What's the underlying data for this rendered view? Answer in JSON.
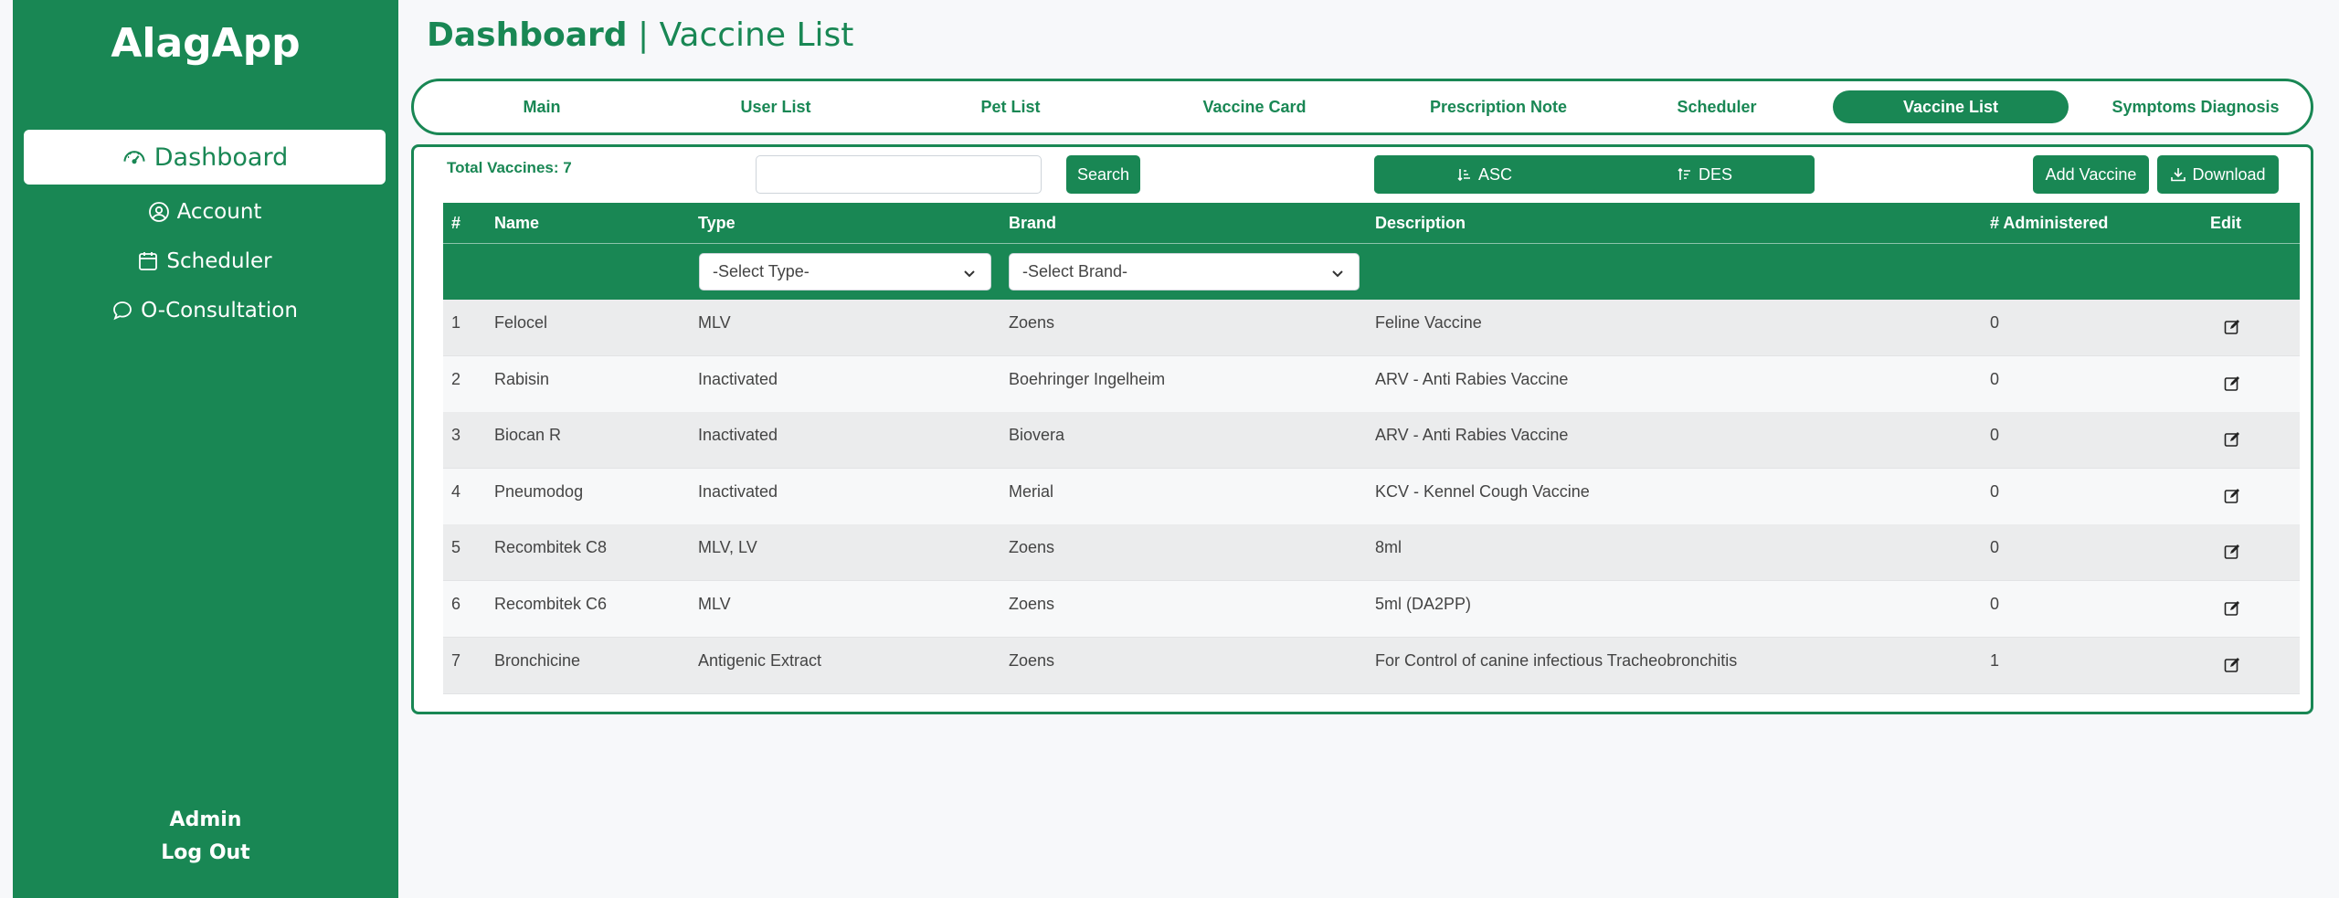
{
  "sidebar": {
    "brand": "AlagApp",
    "items": [
      {
        "label": "Dashboard",
        "icon": "speedometer-icon",
        "active": true
      },
      {
        "label": "Account",
        "icon": "person-circle-icon"
      },
      {
        "label": "Scheduler",
        "icon": "calendar-icon"
      },
      {
        "label": "O-Consultation",
        "icon": "chat-icon"
      }
    ],
    "user": "Admin",
    "logout": "Log Out"
  },
  "header": {
    "title_bold": "Dashboard",
    "separator": " | ",
    "title_rest": "Vaccine List"
  },
  "tabs": [
    {
      "label": "Main"
    },
    {
      "label": "User List"
    },
    {
      "label": "Pet List"
    },
    {
      "label": "Vaccine Card"
    },
    {
      "label": "Prescription Note"
    },
    {
      "label": "Scheduler"
    },
    {
      "label": "Vaccine List",
      "active": true
    },
    {
      "label": "Symptoms Diagnosis"
    }
  ],
  "toolbar": {
    "total_label": "Total Vaccines: 7",
    "search_value": "",
    "search_button": "Search",
    "asc_label": "ASC",
    "des_label": "DES",
    "add_label": "Add Vaccine",
    "download_label": "Download"
  },
  "table": {
    "headers": [
      "#",
      "Name",
      "Type",
      "Brand",
      "Description",
      "# Administered",
      "Edit"
    ],
    "type_filter": "-Select Type-",
    "brand_filter": "-Select Brand-",
    "rows": [
      {
        "num": "1",
        "name": "Felocel",
        "type": "MLV",
        "brand": "Zoens",
        "description": "Feline Vaccine",
        "administered": "0"
      },
      {
        "num": "2",
        "name": "Rabisin",
        "type": "Inactivated",
        "brand": "Boehringer Ingelheim",
        "description": "ARV - Anti Rabies Vaccine",
        "administered": "0"
      },
      {
        "num": "3",
        "name": "Biocan R",
        "type": "Inactivated",
        "brand": "Biovera",
        "description": "ARV - Anti Rabies Vaccine",
        "administered": "0"
      },
      {
        "num": "4",
        "name": "Pneumodog",
        "type": "Inactivated",
        "brand": "Merial",
        "description": "KCV - Kennel Cough Vaccine",
        "administered": "0"
      },
      {
        "num": "5",
        "name": "Recombitek C8",
        "type": "MLV, LV",
        "brand": "Zoens",
        "description": "8ml",
        "administered": "0"
      },
      {
        "num": "6",
        "name": "Recombitek C6",
        "type": "MLV",
        "brand": "Zoens",
        "description": "5ml (DA2PP)",
        "administered": "0"
      },
      {
        "num": "7",
        "name": "Bronchicine",
        "type": "Antigenic Extract",
        "brand": "Zoens",
        "description": "For Control of canine infectious Tracheobronchitis",
        "administered": "1"
      }
    ]
  },
  "colors": {
    "primary": "#198754",
    "row_alt": "#ebeced",
    "background": "#f7f8fa"
  }
}
